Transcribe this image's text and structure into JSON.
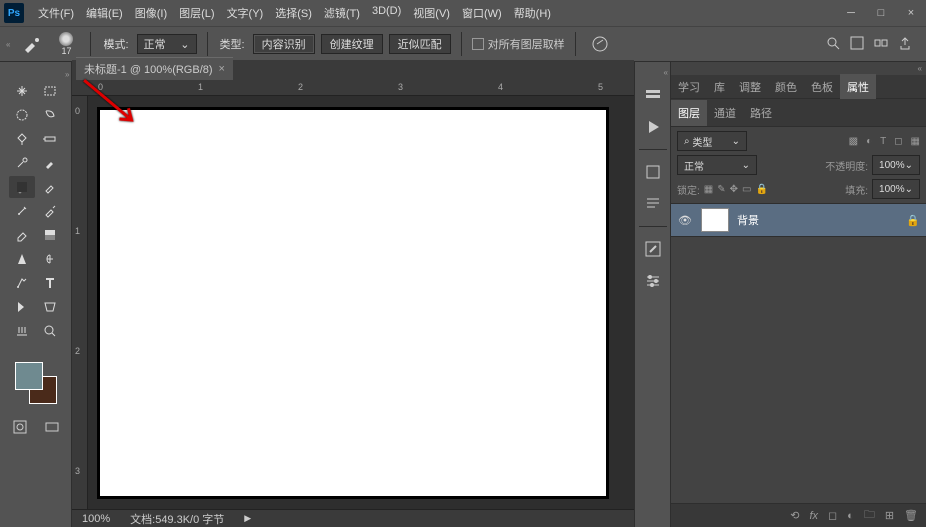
{
  "menus": [
    "文件(F)",
    "编辑(E)",
    "图像(I)",
    "图层(L)",
    "文字(Y)",
    "选择(S)",
    "滤镜(T)",
    "3D(D)",
    "视图(V)",
    "窗口(W)",
    "帮助(H)"
  ],
  "optbar": {
    "brush_size": "17",
    "mode_label": "模式:",
    "mode_value": "正常",
    "type_label": "类型:",
    "btn1": "内容识别",
    "btn2": "创建纹理",
    "btn3": "近似匹配",
    "chk_label": "对所有图层取样"
  },
  "tab_title": "未标题-1 @ 100%(RGB/8)",
  "ruler_h": [
    "0",
    "1",
    "2",
    "3",
    "4",
    "5"
  ],
  "ruler_v": [
    "0",
    "1",
    "2",
    "3"
  ],
  "status": {
    "zoom": "100%",
    "doc": "文档:549.3K/0 字节"
  },
  "panel_tabs_top": [
    "学习",
    "库",
    "调整",
    "颜色",
    "色板",
    "属性"
  ],
  "panel_tabs2": [
    "图层",
    "通道",
    "路径"
  ],
  "layers": {
    "kind_label": "类型",
    "blend": "正常",
    "opacity_label": "不透明度:",
    "opacity_value": "100%",
    "lock_label": "锁定:",
    "fill_label": "填充:",
    "fill_value": "100%",
    "bg_name": "背景"
  },
  "search_placeholder": "类型"
}
